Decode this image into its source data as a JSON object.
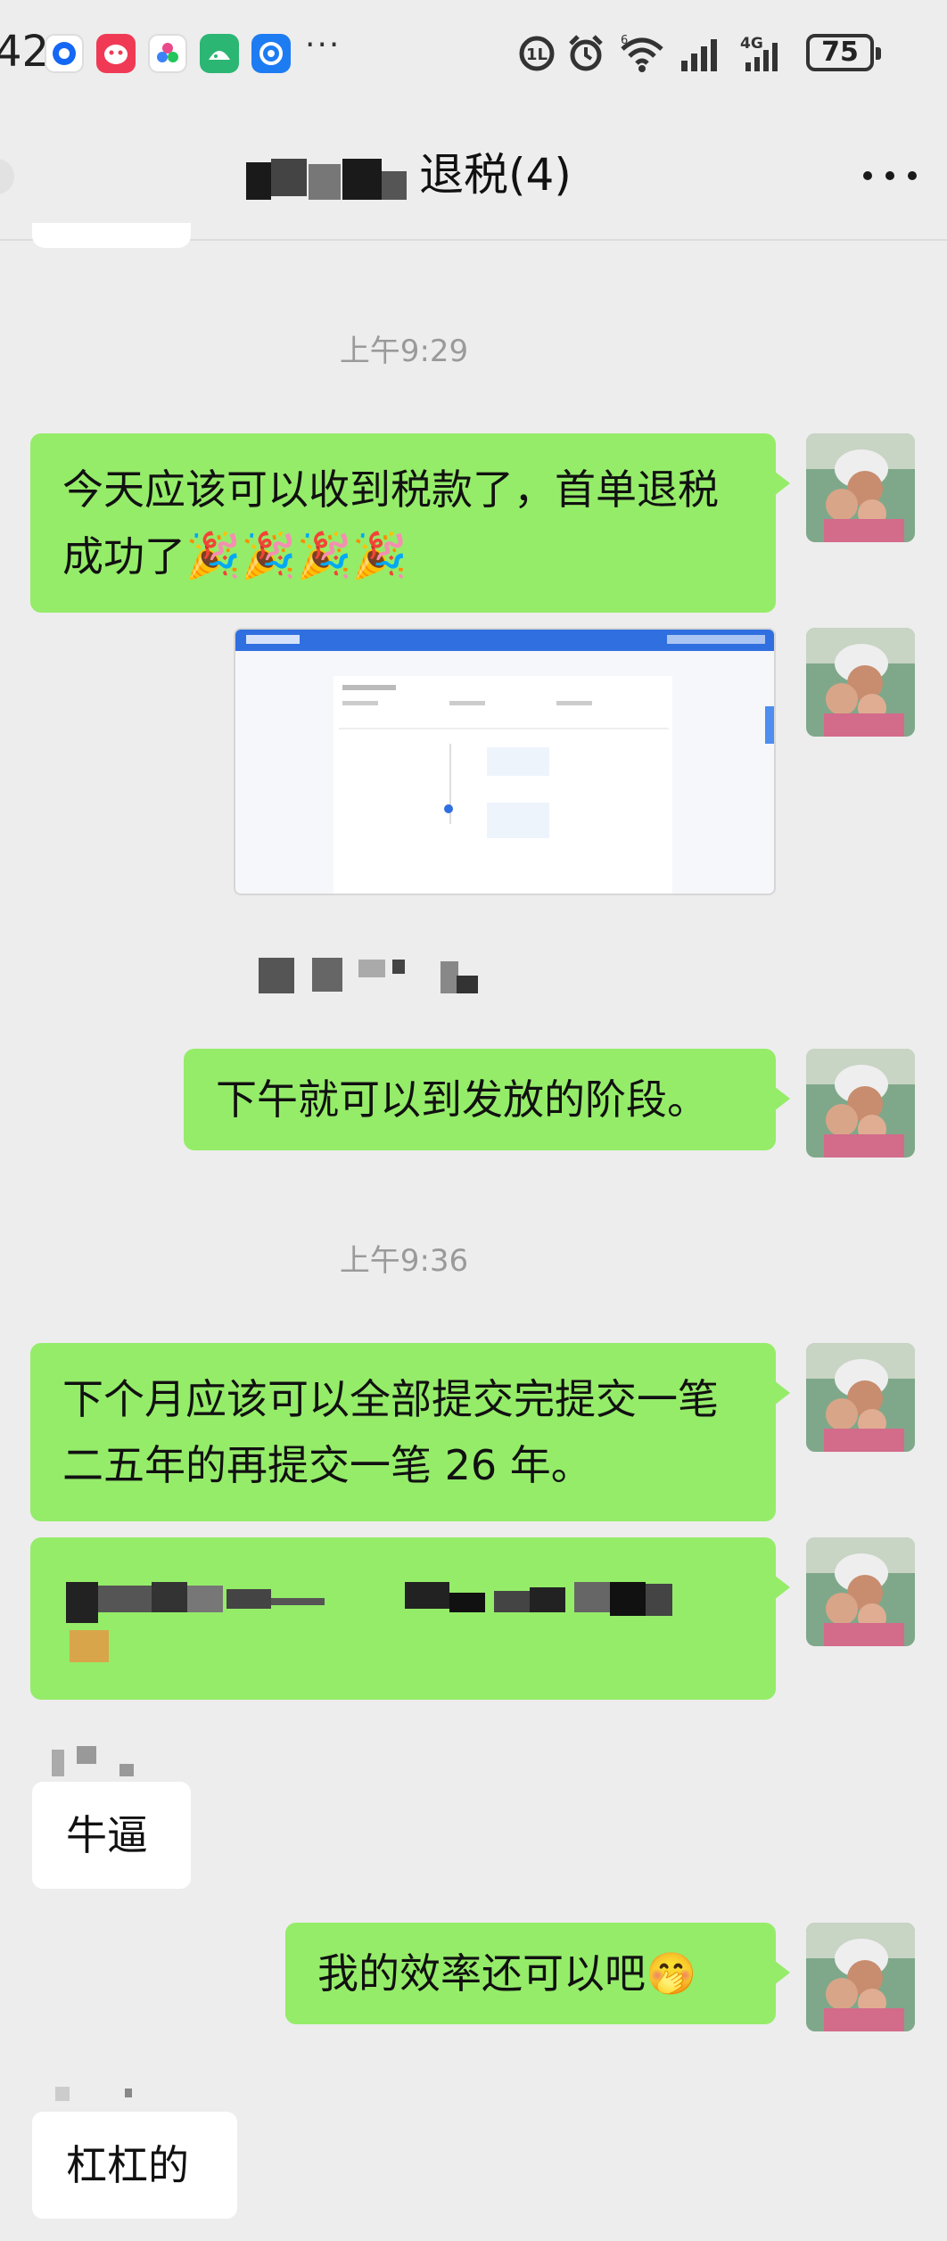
{
  "status_bar": {
    "time_fragment": "42",
    "overflow_dots": "···",
    "battery": "75",
    "network": "4G",
    "apps": [
      "blue-circle-app-icon",
      "red-app-icon",
      "colorful-app-icon",
      "green-app-icon",
      "blue-swirl-app-icon"
    ]
  },
  "header": {
    "title_visible": "退税(4)"
  },
  "messages": {
    "time_1": "上午9:29",
    "msg_1_text": "今天应该可以收到税款了，首单退税成功了",
    "msg_1_emoji": "🎉🎉🎉🎉",
    "msg_3_text": "下午就可以到发放的阶段。",
    "time_2": "上午9:36",
    "msg_4_text": "下个月应该可以全部提交完提交一笔二五年的再提交一笔 26 年。",
    "msg_6_text": "牛逼",
    "msg_7_text": "我的效率还可以吧",
    "msg_7_emoji": "🤭",
    "msg_8_text": "杠杠的"
  },
  "colors": {
    "outgoing_bubble": "#95ec69",
    "incoming_bubble": "#ffffff",
    "background": "#ededed",
    "timestamp": "#9a9a9a"
  }
}
